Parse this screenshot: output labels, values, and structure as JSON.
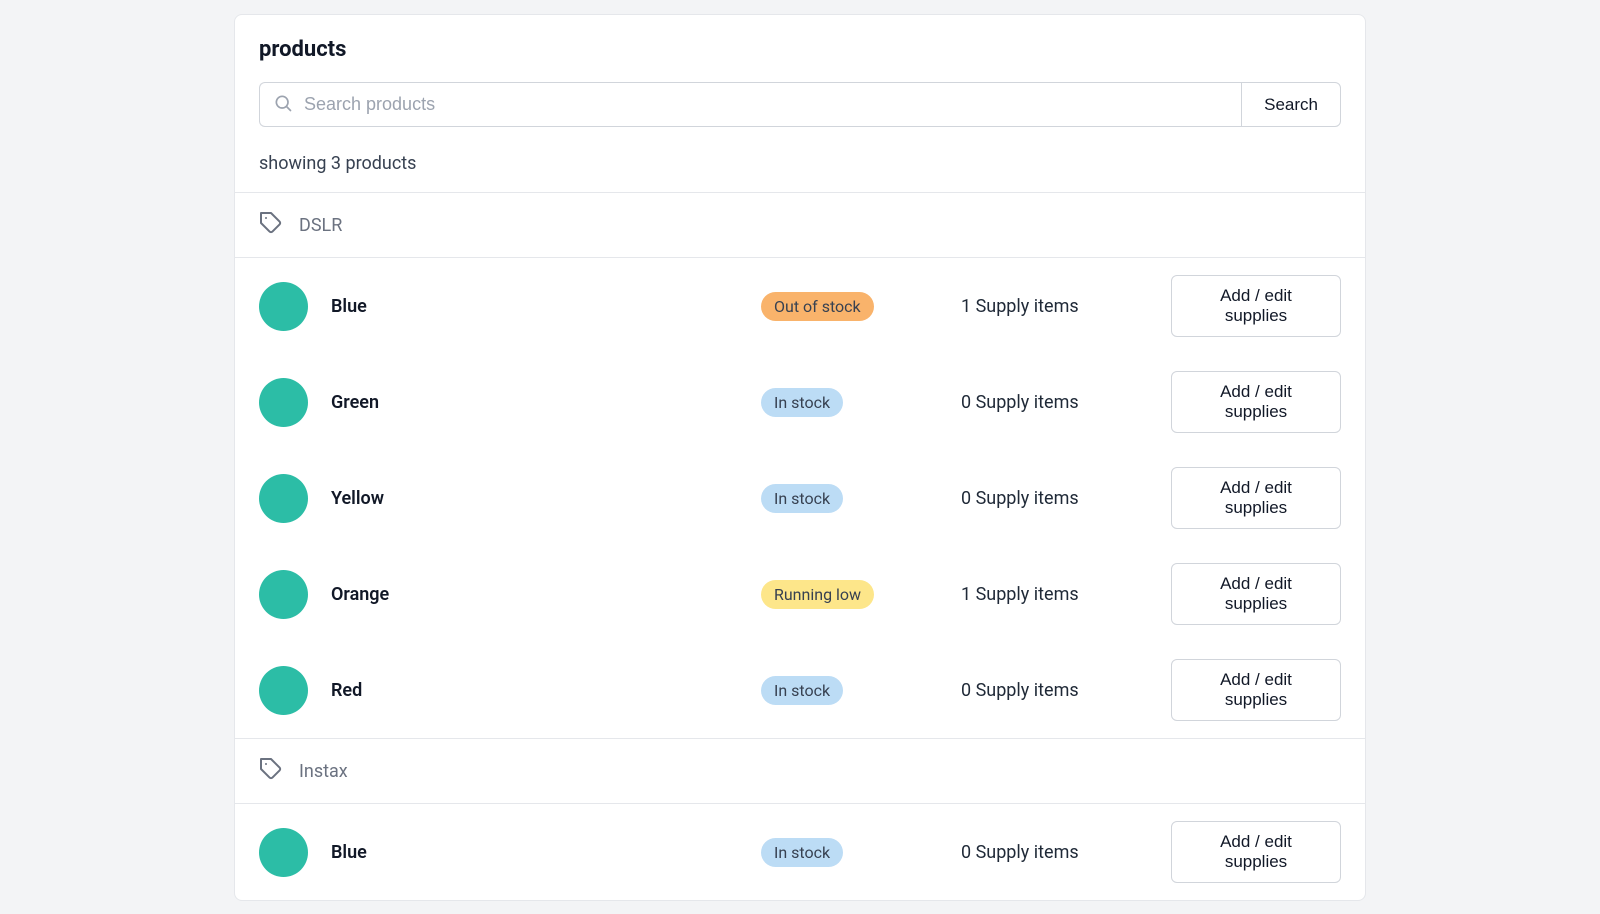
{
  "title": "products",
  "search": {
    "placeholder": "Search products",
    "button": "Search"
  },
  "count_text": "showing 3 products",
  "action_label": "Add / edit supplies",
  "groups": [
    {
      "label": "DSLR",
      "rows": [
        {
          "name": "Blue",
          "status": "Out of stock",
          "status_kind": "orange",
          "supply": "1 Supply items"
        },
        {
          "name": "Green",
          "status": "In stock",
          "status_kind": "blue",
          "supply": "0 Supply items"
        },
        {
          "name": "Yellow",
          "status": "In stock",
          "status_kind": "blue",
          "supply": "0 Supply items"
        },
        {
          "name": "Orange",
          "status": "Running low",
          "status_kind": "yellow",
          "supply": "1 Supply items"
        },
        {
          "name": "Red",
          "status": "In stock",
          "status_kind": "blue",
          "supply": "0 Supply items"
        }
      ]
    },
    {
      "label": "Instax",
      "rows": [
        {
          "name": "Blue",
          "status": "In stock",
          "status_kind": "blue",
          "supply": "0 Supply items"
        }
      ]
    }
  ]
}
